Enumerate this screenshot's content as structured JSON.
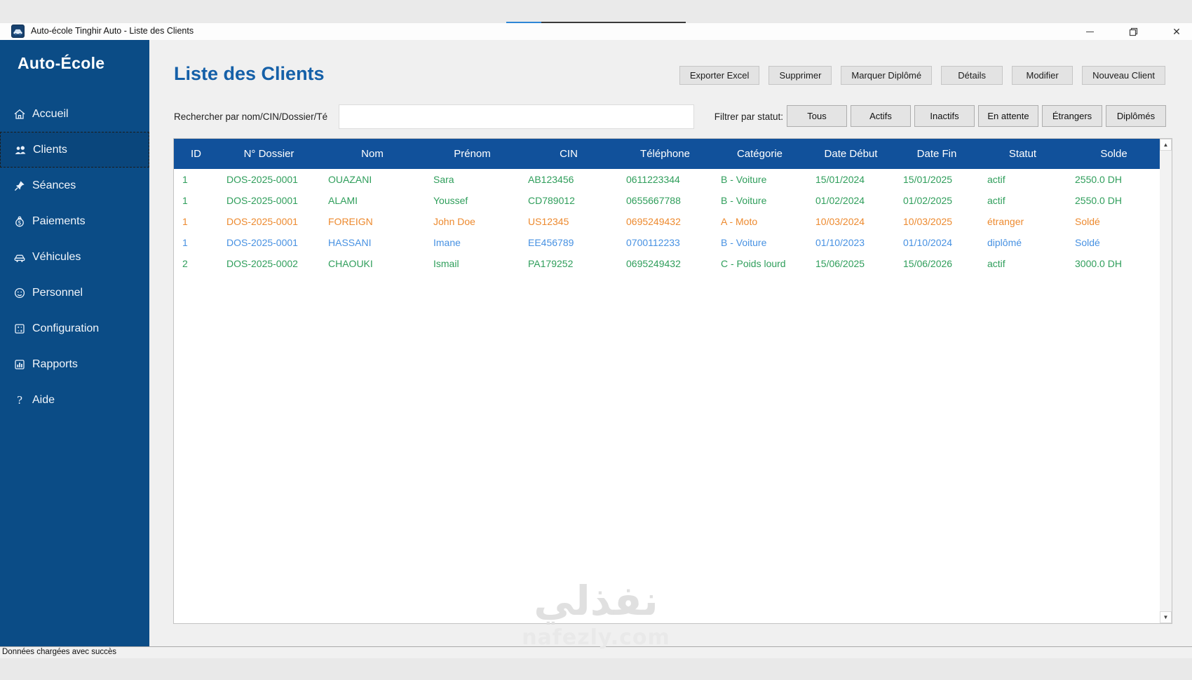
{
  "window": {
    "title": "Auto-école Tinghir Auto - Liste des Clients"
  },
  "sidebar": {
    "brand": "Auto-École",
    "items": [
      {
        "label": "Accueil",
        "icon": "home-icon",
        "active": false
      },
      {
        "label": "Clients",
        "icon": "clients-icon",
        "active": true
      },
      {
        "label": "Séances",
        "icon": "pin-icon",
        "active": false
      },
      {
        "label": "Paiements",
        "icon": "money-icon",
        "active": false
      },
      {
        "label": "Véhicules",
        "icon": "car-icon",
        "active": false
      },
      {
        "label": "Personnel",
        "icon": "person-icon",
        "active": false
      },
      {
        "label": "Configuration",
        "icon": "settings-icon",
        "active": false
      },
      {
        "label": "Rapports",
        "icon": "chart-icon",
        "active": false
      },
      {
        "label": "Aide",
        "icon": "help-icon",
        "active": false
      }
    ]
  },
  "page": {
    "title": "Liste des Clients"
  },
  "toolbar": {
    "export": "Exporter Excel",
    "delete": "Supprimer",
    "mark_graduated": "Marquer Diplômé",
    "details": "Détails",
    "edit": "Modifier",
    "new_client": "Nouveau Client"
  },
  "search": {
    "label": "Rechercher par nom/CIN/Dossier/Té",
    "value": "",
    "placeholder": ""
  },
  "filters": {
    "label": "Filtrer par statut:",
    "all": "Tous",
    "active": "Actifs",
    "inactive": "Inactifs",
    "waiting": "En attente",
    "foreign": "Étrangers",
    "graduated": "Diplômés"
  },
  "table": {
    "columns": [
      "ID",
      "N° Dossier",
      "Nom",
      "Prénom",
      "CIN",
      "Téléphone",
      "Catégorie",
      "Date Début",
      "Date Fin",
      "Statut",
      "Solde"
    ],
    "rows": [
      {
        "color": "green",
        "cells": [
          "1",
          "DOS-2025-0001",
          "OUAZANI",
          "Sara",
          "AB123456",
          "0611223344",
          "B - Voiture",
          "15/01/2024",
          "15/01/2025",
          "actif",
          "2550.0 DH"
        ]
      },
      {
        "color": "green",
        "cells": [
          "1",
          "DOS-2025-0001",
          "ALAMI",
          "Youssef",
          "CD789012",
          "0655667788",
          "B - Voiture",
          "01/02/2024",
          "01/02/2025",
          "actif",
          "2550.0 DH"
        ]
      },
      {
        "color": "orange",
        "cells": [
          "1",
          "DOS-2025-0001",
          "FOREIGN",
          "John Doe",
          "US12345",
          "0695249432",
          "A - Moto",
          "10/03/2024",
          "10/03/2025",
          "étranger",
          "Soldé"
        ]
      },
      {
        "color": "blue",
        "cells": [
          "1",
          "DOS-2025-0001",
          "HASSANI",
          "Imane",
          "EE456789",
          "0700112233",
          "B - Voiture",
          "01/10/2023",
          "01/10/2024",
          "diplômé",
          "Soldé"
        ]
      },
      {
        "color": "green",
        "cells": [
          "2",
          "DOS-2025-0002",
          "CHAOUKI",
          "Ismail",
          "PA179252",
          "0695249432",
          "C - Poids lourd",
          "15/06/2025",
          "15/06/2026",
          "actif",
          "3000.0 DH"
        ]
      }
    ]
  },
  "statusbar": {
    "message": "Données chargées avec succès"
  },
  "watermark": {
    "arabic": "نفذلي",
    "domain": "nafezly.com"
  },
  "colors": {
    "sidebar_bg": "#0b4c86",
    "table_header_bg": "#11519b",
    "page_title": "#1560a8",
    "row_green": "#2f9e5b",
    "row_orange": "#ed8a2f",
    "row_blue": "#4791e2"
  }
}
